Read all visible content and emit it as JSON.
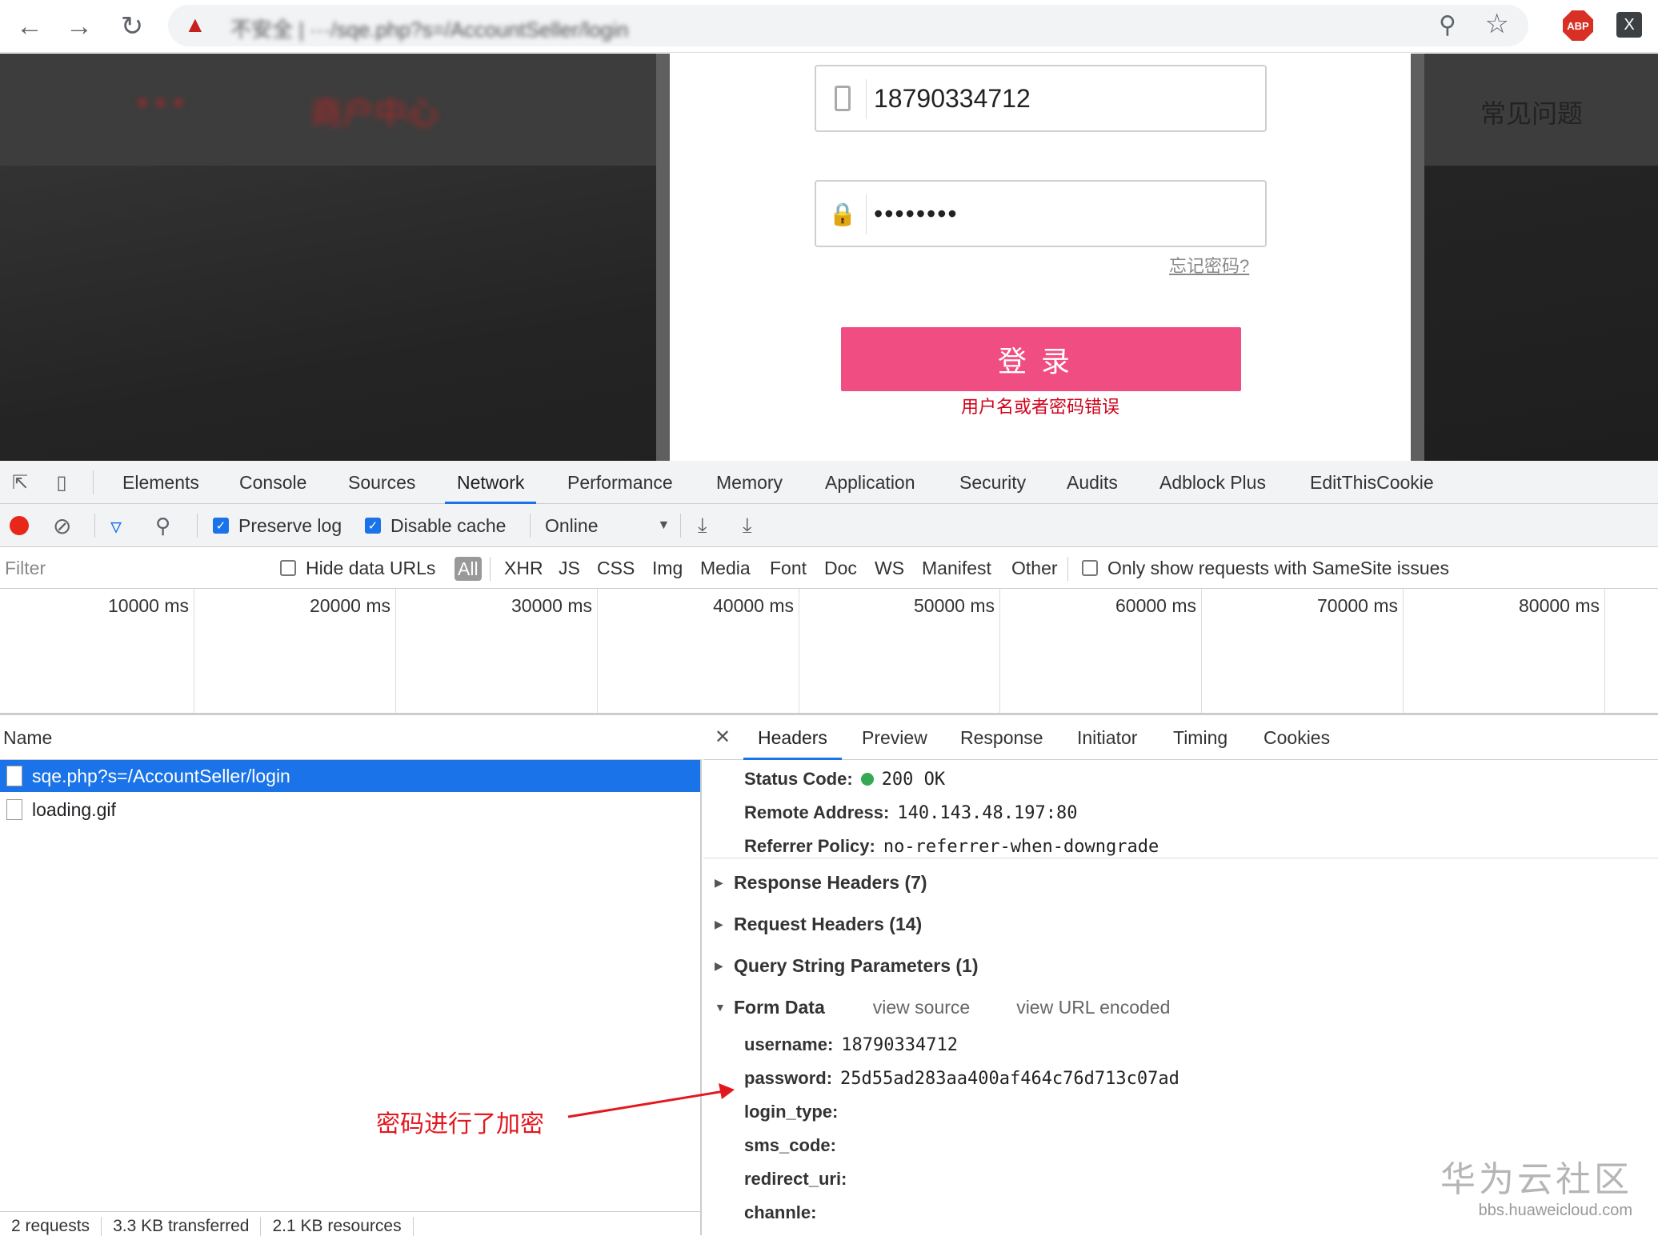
{
  "browser": {
    "url_label": "不安全 | ···/sqe.php?s=/AccountSeller/login",
    "extensions": {
      "abp": "ABP",
      "x": "X"
    }
  },
  "page": {
    "site_logo": "···",
    "site_sub": "商户中心",
    "faq": "常见问题",
    "login": {
      "phone": "18790334712",
      "password_masked": "••••••••",
      "forgot": "忘记密码?",
      "button": "登录",
      "error": "用户名或者密码错误"
    }
  },
  "devtools": {
    "tabs": [
      "Elements",
      "Console",
      "Sources",
      "Network",
      "Performance",
      "Memory",
      "Application",
      "Security",
      "Audits",
      "Adblock Plus",
      "EditThisCookie"
    ],
    "active_tab": "Network",
    "toolbar": {
      "preserve_log": "Preserve log",
      "disable_cache": "Disable cache",
      "throttle": "Online"
    },
    "filter": {
      "placeholder": "Filter",
      "hide_data_urls": "Hide data URLs",
      "types": [
        "All",
        "XHR",
        "JS",
        "CSS",
        "Img",
        "Media",
        "Font",
        "Doc",
        "WS",
        "Manifest",
        "Other"
      ],
      "samesite": "Only show requests with SameSite issues"
    },
    "timeline_ticks": [
      "10000 ms",
      "20000 ms",
      "30000 ms",
      "40000 ms",
      "50000 ms",
      "60000 ms",
      "70000 ms",
      "80000 ms"
    ],
    "requests": {
      "header": "Name",
      "items": [
        {
          "name": "sqe.php?s=/AccountSeller/login"
        },
        {
          "name": "loading.gif"
        }
      ],
      "footer": [
        "2 requests",
        "3.3 KB transferred",
        "2.1 KB resources"
      ]
    },
    "details": {
      "tabs": [
        "Headers",
        "Preview",
        "Response",
        "Initiator",
        "Timing",
        "Cookies"
      ],
      "general": [
        {
          "k": "Status Code:",
          "v": "200  OK"
        },
        {
          "k": "Remote Address:",
          "v": "140.143.48.197:80"
        },
        {
          "k": "Referrer Policy:",
          "v": "no-referrer-when-downgrade"
        }
      ],
      "sections": [
        "Response Headers (7)",
        "Request Headers (14)",
        "Query String Parameters (1)"
      ],
      "form_data": {
        "title": "Form Data",
        "view_source": "view source",
        "view_url_encoded": "view URL encoded",
        "fields": [
          {
            "k": "username:",
            "v": "18790334712"
          },
          {
            "k": "password:",
            "v": "25d55ad283aa400af464c76d713c07ad"
          },
          {
            "k": "login_type:",
            "v": ""
          },
          {
            "k": "sms_code:",
            "v": ""
          },
          {
            "k": "redirect_uri:",
            "v": ""
          },
          {
            "k": "channle:",
            "v": ""
          }
        ]
      }
    }
  },
  "annotation": {
    "text": "密码进行了加密",
    "color": "#e3181f"
  },
  "watermark": {
    "cn": "华为云社区",
    "url": "bbs.huaweicloud.com"
  },
  "colors": {
    "accent": "#1a73e8",
    "login_button": "#f04d82",
    "error": "#d0021b"
  }
}
